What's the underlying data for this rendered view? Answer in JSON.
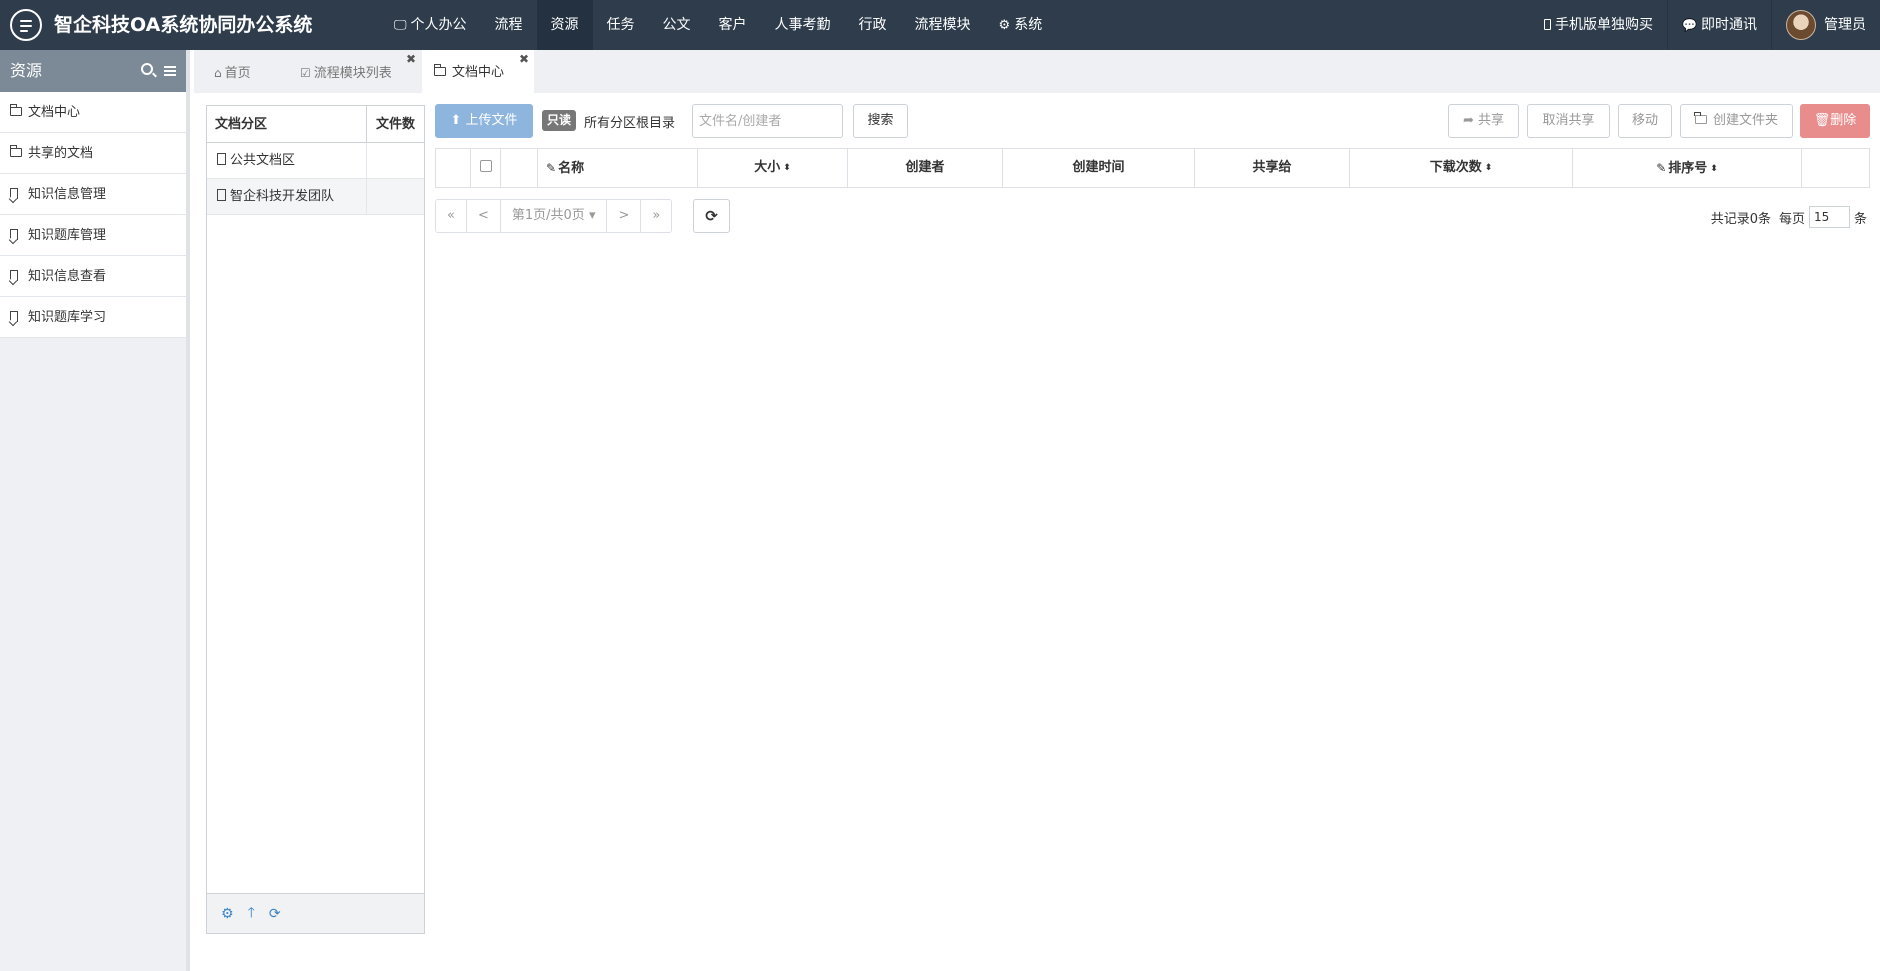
{
  "app": {
    "title": "智企科技OA系统协同办公系统"
  },
  "nav": {
    "items": [
      {
        "label": "个人办公",
        "icon": "monitor-icon"
      },
      {
        "label": "流程"
      },
      {
        "label": "资源",
        "active": true
      },
      {
        "label": "任务"
      },
      {
        "label": "公文"
      },
      {
        "label": "客户"
      },
      {
        "label": "人事考勤"
      },
      {
        "label": "行政"
      },
      {
        "label": "流程模块"
      },
      {
        "label": "系统",
        "icon": "gear-icon"
      }
    ],
    "right": {
      "mobile": "手机版单独购买",
      "im": "即时通讯",
      "user": "管理员"
    }
  },
  "sidebar": {
    "title": "资源",
    "items": [
      {
        "label": "文档中心",
        "icon": "folder-icon"
      },
      {
        "label": "共享的文档",
        "icon": "folder-open-icon"
      },
      {
        "label": "知识信息管理",
        "icon": "bookmark-icon"
      },
      {
        "label": "知识题库管理",
        "icon": "bookmark-icon"
      },
      {
        "label": "知识信息查看",
        "icon": "bookmark-icon"
      },
      {
        "label": "知识题库学习",
        "icon": "bookmark-icon"
      }
    ]
  },
  "tabs": [
    {
      "label": "首页",
      "icon": "home-icon"
    },
    {
      "label": "流程模块列表",
      "icon": "checkbox-icon"
    },
    {
      "label": "文档中心",
      "icon": "folder-icon",
      "active": true
    }
  ],
  "areas": {
    "col_name": "文档分区",
    "col_count": "文件数",
    "rows": [
      {
        "name": "公共文档区",
        "count": ""
      },
      {
        "name": "智企科技开发团队",
        "count": ""
      }
    ]
  },
  "toolbar": {
    "upload": "上传文件",
    "readonly_badge": "只读",
    "scope": "所有分区根目录",
    "search_placeholder": "文件名/创建者",
    "search_value": "",
    "search_button": "搜索",
    "share": "共享",
    "unshare": "取消共享",
    "move": "移动",
    "mkdir": "创建文件夹",
    "delete": "删除"
  },
  "grid": {
    "columns": [
      "名称",
      "大小",
      "创建者",
      "创建时间",
      "共享给",
      "下载次数",
      "排序号"
    ]
  },
  "pager": {
    "first": "«",
    "prev": "<",
    "page": "第1页/共0页",
    "next": ">",
    "last": "»",
    "total_label": "共记录0条",
    "per_page_label": "每页",
    "per_page_value": "15",
    "unit": "条"
  },
  "colors": {
    "topbar": "#2e3c4c",
    "primary_button": "#8db5de",
    "danger_button": "#e98c8c",
    "icon_blue": "#3b83c4"
  }
}
